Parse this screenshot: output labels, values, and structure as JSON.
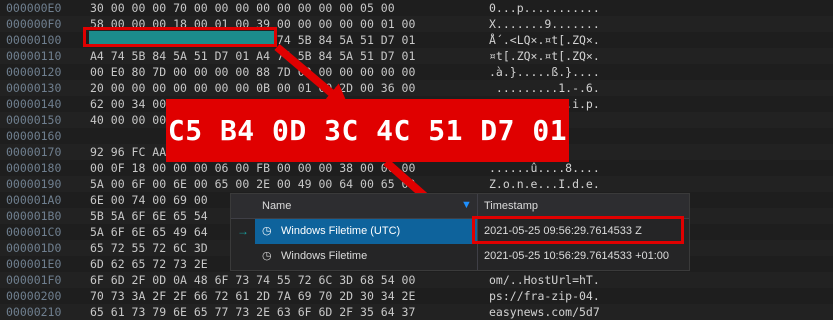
{
  "hex_rows": [
    {
      "offset": "000000E0",
      "bytes": "30 00 00 00 70 00 00 00 00 00 00 00 00 05 00",
      "ascii": "0...p..........."
    },
    {
      "offset": "000000F0",
      "bytes": "58 00 00 00 18 00 01 00 39 00 00 00 00 00 01 00",
      "ascii": "X.......9......."
    },
    {
      "offset": "00000100",
      "bytes": "C5 B4 0D 3C 4C 51 D7 01 A4 74 5B 84 5A 51 D7 01",
      "ascii": "Å´.<LQ×.¤t[.ZQ×."
    },
    {
      "offset": "00000110",
      "bytes": "A4 74 5B 84 5A 51 D7 01 A4 74 5B 84 5A 51 D7 01",
      "ascii": "¤t[.ZQ×.¤t[.ZQ×."
    },
    {
      "offset": "00000120",
      "bytes": "00 E0 80 7D 00 00 00 00 88 7D 00 00 00 00 00 00",
      "ascii": ".à.}.....ß.}...."
    },
    {
      "offset": "00000130",
      "bytes": "20 00 00 00 00 00 00 00 0B 00 01 00 2D 00 36 00",
      "ascii": " .........1.-.6."
    },
    {
      "offset": "00000140",
      "bytes": "62 00 34 00 62 00 39 00 2E 00 7A 00 69 00 70 00",
      "ascii": "b.4.b.9...z.i.p."
    },
    {
      "offset": "00000150",
      "bytes": "40 00 00 00",
      "ascii": ""
    },
    {
      "offset": "00000160",
      "bytes": "",
      "ascii": "rõ.0%ë."
    },
    {
      "offset": "00000170",
      "bytes": "92 96 FC AA",
      "ascii": "...8..."
    },
    {
      "offset": "00000180",
      "bytes": "00 0F 18 00 00 00 06 00 FB 00 00 00 38 00 00 00",
      "ascii": "......û....8...."
    },
    {
      "offset": "00000190",
      "bytes": "5A 00 6F 00 6E 00 65 00 2E 00 49 00 64 00 65 00",
      "ascii": "Z.o.n.e...I.d.e."
    },
    {
      "offset": "000001A0",
      "bytes": "6E 00 74 00 69 00",
      "ascii": ""
    },
    {
      "offset": "000001B0",
      "bytes": "5B 5A 6F 6E 65 54",
      "ascii": ""
    },
    {
      "offset": "000001C0",
      "bytes": "5A 6F 6E 65 49 64",
      "ascii": ""
    },
    {
      "offset": "000001D0",
      "bytes": "65 72 55 72 6C 3D",
      "ascii": ""
    },
    {
      "offset": "000001E0",
      "bytes": "6D 62 65 72 73 2E",
      "ascii": ""
    },
    {
      "offset": "000001F0",
      "bytes": "6F 6D 2F 0D 0A 48 6F 73 74 55 72 6C 3D 68 54 00",
      "ascii": "om/..HostUrl=hT."
    },
    {
      "offset": "00000200",
      "bytes": "70 73 3A 2F 2F 66 72 61 2D 7A 69 70 2D 30 34 2E",
      "ascii": "ps://fra-zip-04."
    },
    {
      "offset": "00000210",
      "bytes": "65 61 73 79 6E 65 77 73 2E 63 6F 6D 2F 35 64 37",
      "ascii": "easynews.com/5d7"
    }
  ],
  "callout_text": "C5 B4 0D 3C 4C 51 D7 01",
  "popup": {
    "col_name": "Name",
    "col_timestamp": "Timestamp",
    "rows": [
      {
        "name": "Windows Filetime (UTC)",
        "timestamp": "2021-05-25 09:56:29.7614533 Z"
      },
      {
        "name": "Windows Filetime",
        "timestamp": "2021-05-25 10:56:29.7614533 +01:00"
      }
    ]
  },
  "icons": {
    "arrow": "arrow-right",
    "clock": "clock-icon",
    "filter": "filter-icon"
  },
  "colors": {
    "highlight": "#e00000",
    "selection": "#1b8c8c",
    "selected_row": "#0e639c"
  }
}
